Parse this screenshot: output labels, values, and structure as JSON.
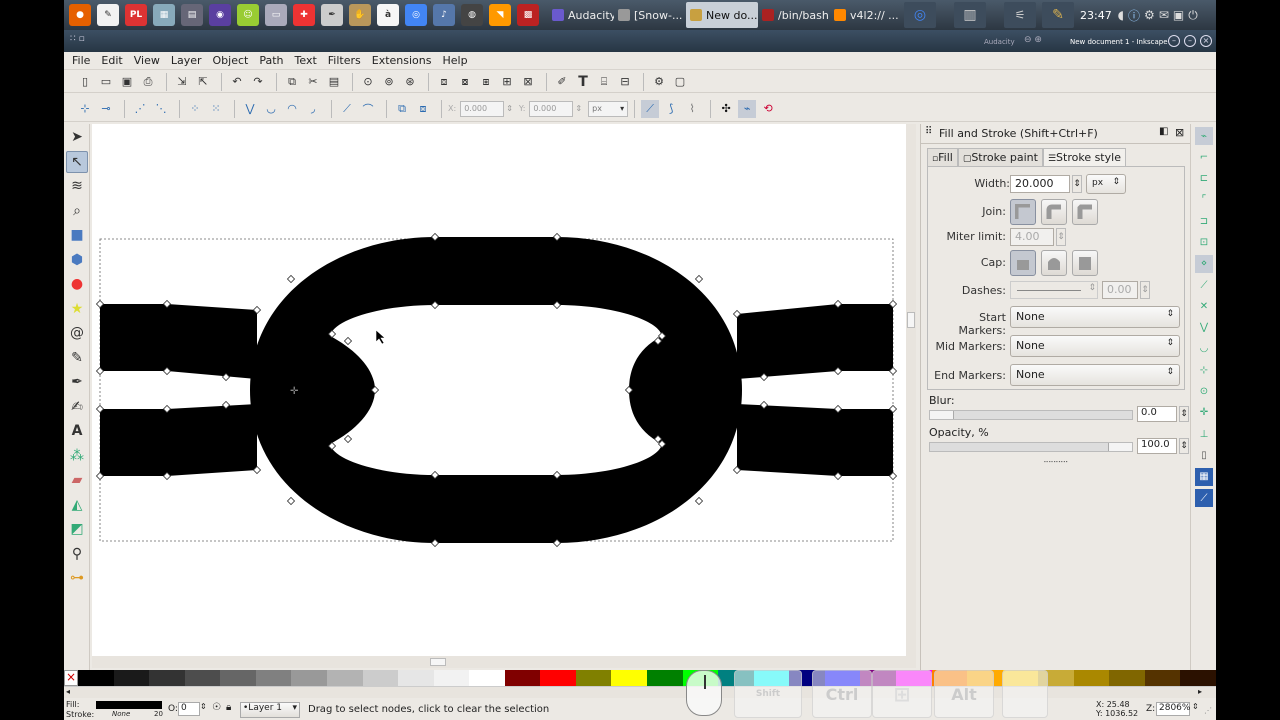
{
  "taskbar": {
    "launchers": [
      {
        "name": "firefox-icon",
        "color": "#e66000",
        "glyph": "●"
      },
      {
        "name": "text-editor-icon",
        "color": "#f2f2f2",
        "glyph": "✎"
      },
      {
        "name": "projectlibre-icon",
        "color": "#d33",
        "glyph": "PL",
        "text": "Project\nLibre"
      },
      {
        "name": "image-viewer-icon",
        "color": "#8ab",
        "glyph": "▦"
      },
      {
        "name": "calculator-icon",
        "color": "#667",
        "glyph": "▤"
      },
      {
        "name": "podcast-icon",
        "color": "#5a3fa0",
        "glyph": "◉"
      },
      {
        "name": "android-icon",
        "color": "#9c3",
        "glyph": "☺"
      },
      {
        "name": "disk-icon",
        "color": "#aab",
        "glyph": "▭"
      },
      {
        "name": "rescue-icon",
        "color": "#e33",
        "glyph": "✚"
      },
      {
        "name": "pen-icon",
        "color": "#ccc",
        "glyph": "✒"
      },
      {
        "name": "gimp-icon",
        "color": "#b9975b",
        "glyph": "✋"
      },
      {
        "name": "font-icon",
        "color": "#f6f6f6",
        "glyph": "à"
      },
      {
        "name": "chrome-icon",
        "color": "#4285f4",
        "glyph": "◎"
      },
      {
        "name": "notes-icon",
        "color": "#57a",
        "glyph": "♪"
      },
      {
        "name": "music-icon",
        "color": "#444",
        "glyph": "◍"
      },
      {
        "name": "rss-icon",
        "color": "#f90",
        "glyph": "◥"
      },
      {
        "name": "grid-app-icon",
        "color": "#b22",
        "glyph": "▩"
      }
    ],
    "tasks": [
      {
        "label": "Audacity",
        "icon": "headphones-icon",
        "color": "#6a5acd",
        "active": false
      },
      {
        "label": "[Snow-...",
        "icon": "window-icon",
        "color": "#999",
        "active": false
      },
      {
        "label": "New do...",
        "icon": "inkscape-task-icon",
        "color": "#c8a040",
        "active": true
      },
      {
        "label": "/bin/bash",
        "icon": "terminal-icon",
        "color": "#a22",
        "active": false
      },
      {
        "label": "v4l2:// ...",
        "icon": "vlc-icon",
        "color": "#f80",
        "active": false
      }
    ],
    "clock": "23:47"
  },
  "window": {
    "app_name": "Audacity",
    "title": "New document 1 - Inkscape"
  },
  "menu": [
    "File",
    "Edit",
    "View",
    "Layer",
    "Object",
    "Path",
    "Text",
    "Filters",
    "Extensions",
    "Help"
  ],
  "node_controls": {
    "x_label": "X:",
    "x_value": "0.000",
    "y_label": "Y:",
    "y_value": "0.000",
    "unit": "px"
  },
  "dialog": {
    "title": "Fill and Stroke (Shift+Ctrl+F)",
    "tabs": [
      "Fill",
      "Stroke paint",
      "Stroke style"
    ],
    "active_tab": "Stroke style",
    "width_label": "Width:",
    "width_value": "20.000",
    "width_unit": "px",
    "join_label": "Join:",
    "miter_label": "Miter limit:",
    "miter_value": "4.00",
    "cap_label": "Cap:",
    "dashes_label": "Dashes:",
    "dashes_offset": "0.00",
    "start_markers_label": "Start Markers:",
    "start_markers_value": "None",
    "mid_markers_label": "Mid Markers:",
    "mid_markers_value": "None",
    "end_markers_label": "End Markers:",
    "end_markers_value": "None",
    "blur_label": "Blur:",
    "blur_value": "0.0",
    "opacity_label": "Opacity, %",
    "opacity_value": "100.0"
  },
  "status": {
    "fill_label": "Fill:",
    "stroke_label": "Stroke:",
    "stroke_value": "None",
    "stroke_width": "20",
    "opacity_value": "0",
    "layer": "•Layer 1",
    "message": "Drag to select nodes, click to clear the selection",
    "x_coord": "X: 25.48",
    "y_coord": "Y: 1036.52",
    "zoom_label": "Z:",
    "zoom_value": "2806%"
  },
  "osk_keys": [
    "Shift",
    "Ctrl",
    "",
    "Alt",
    ""
  ],
  "palette": [
    "#000000",
    "#1a1a1a",
    "#333333",
    "#4d4d4d",
    "#666666",
    "#808080",
    "#999999",
    "#b3b3b3",
    "#cccccc",
    "#e6e6e6",
    "#f2f2f2",
    "#ffffff",
    "#800000",
    "#ff0000",
    "#808000",
    "#ffff00",
    "#008000",
    "#00ff00",
    "#008080",
    "#00ffff",
    "#000080",
    "#0000ff",
    "#800080",
    "#ff00ff",
    "#ff8000",
    "#ffaa00",
    "#ffd42a",
    "#c8ab37",
    "#aa8800",
    "#806600",
    "#553300",
    "#2b1100"
  ]
}
